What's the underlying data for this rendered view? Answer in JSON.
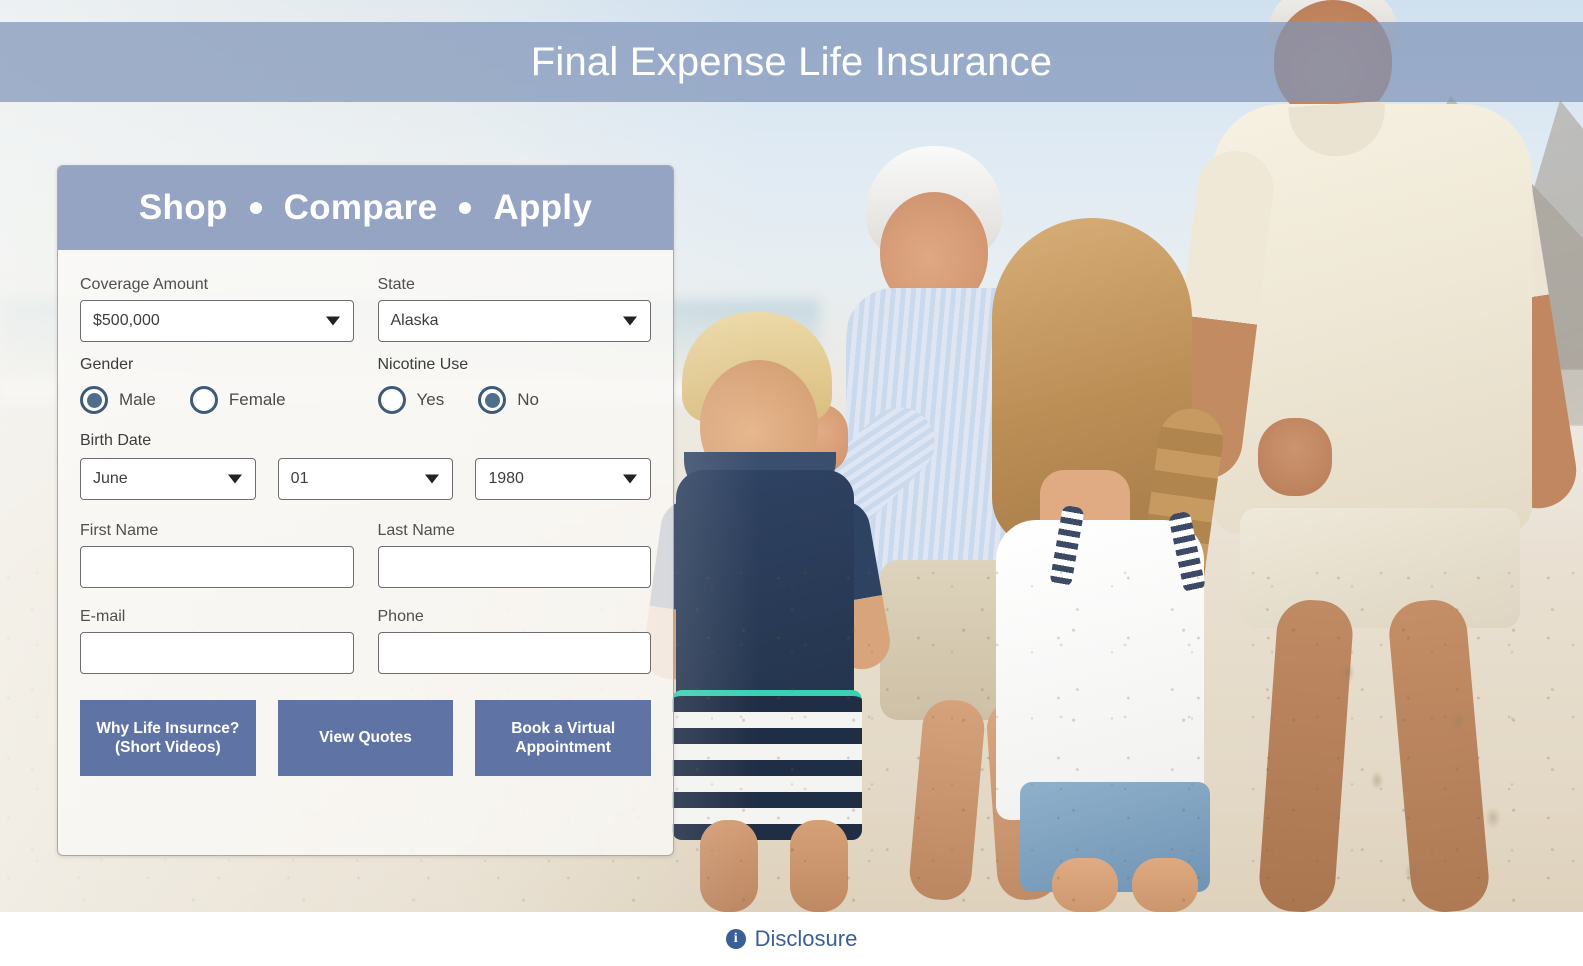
{
  "header": {
    "title": "Final Expense Life Insurance",
    "band_color": "#8094b8"
  },
  "form": {
    "header_words": [
      "Shop",
      "Compare",
      "Apply"
    ],
    "header_bg": "#95a4c3",
    "fields": {
      "coverage_label": "Coverage Amount",
      "coverage_value": "$500,000",
      "state_label": "State",
      "state_value": "Alaska",
      "gender_label": "Gender",
      "gender_options": [
        "Male",
        "Female"
      ],
      "gender_selected": "Male",
      "nicotine_label": "Nicotine Use",
      "nicotine_options": [
        "Yes",
        "No"
      ],
      "nicotine_selected": "No",
      "birthdate_label": "Birth Date",
      "birth_month": "June",
      "birth_day": "01",
      "birth_year": "1980",
      "first_name_label": "First Name",
      "first_name_value": "",
      "last_name_label": "Last Name",
      "last_name_value": "",
      "email_label": "E-mail",
      "email_value": "",
      "phone_label": "Phone",
      "phone_value": ""
    },
    "buttons": {
      "why_line1": "Why Life Insurnce?",
      "why_line2": "(Short Videos)",
      "view_quotes": "View Quotes",
      "book_line1": "Book a Virtual",
      "book_line2": "Appointment",
      "color": "#5f74a5"
    }
  },
  "footer": {
    "disclosure_label": "Disclosure",
    "disclosure_icon": "info-icon",
    "link_color": "#3a5f96"
  }
}
